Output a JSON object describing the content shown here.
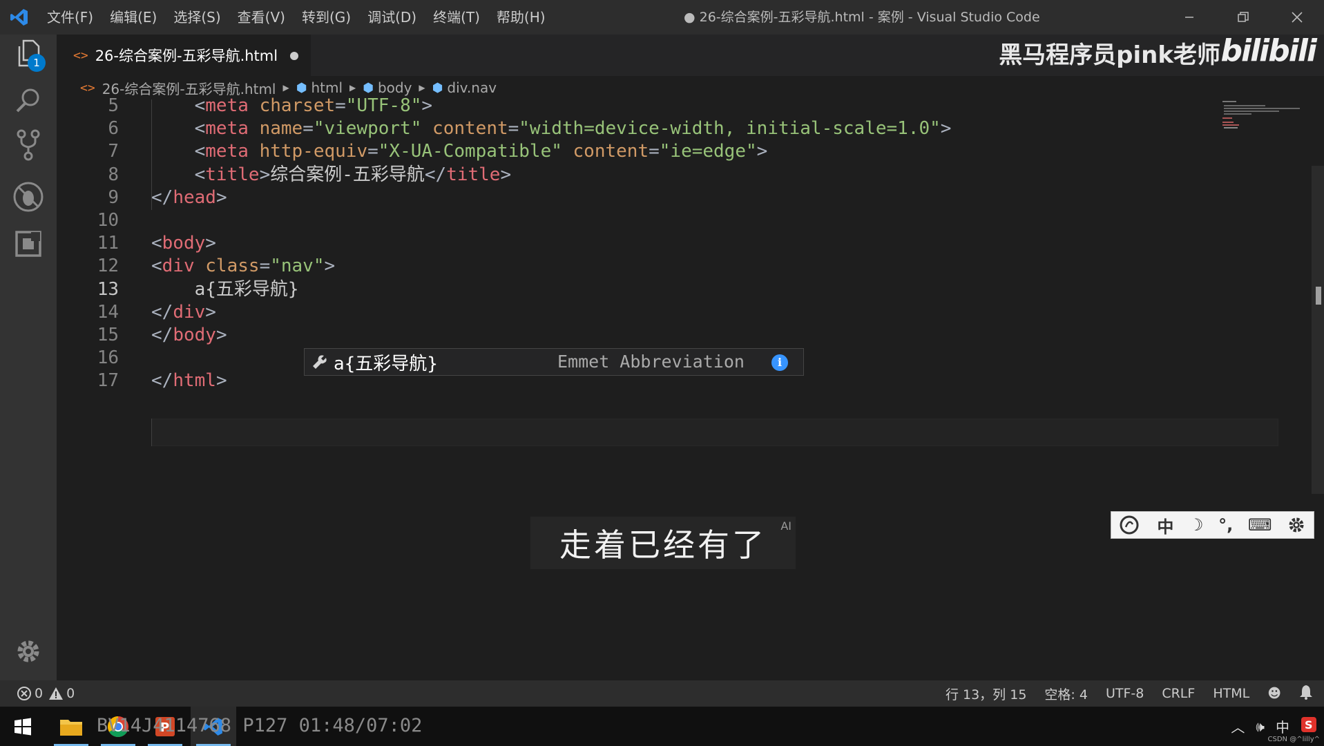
{
  "window": {
    "title": "● 26-综合案例-五彩导航.html - 案例 - Visual Studio Code"
  },
  "menu": [
    "文件(F)",
    "编辑(E)",
    "选择(S)",
    "查看(V)",
    "转到(G)",
    "调试(D)",
    "终端(T)",
    "帮助(H)"
  ],
  "activity": {
    "explorer_badge": "1"
  },
  "tab": {
    "icon": "<>",
    "label": "26-综合案例-五彩导航.html"
  },
  "watermark": {
    "author": "黑马程序员pink老师",
    "logo": "bilibili"
  },
  "breadcrumb": {
    "icon": "<>",
    "file": "26-综合案例-五彩导航.html",
    "items": [
      "html",
      "body",
      "div.nav"
    ]
  },
  "code": {
    "lines": [
      {
        "n": "5",
        "tokens": [
          [
            "p",
            "    "
          ],
          [
            "p",
            "<"
          ],
          [
            "tn",
            "meta"
          ],
          [
            "p",
            " "
          ],
          [
            "an",
            "charset"
          ],
          [
            "p",
            "="
          ],
          [
            "av",
            "\"UTF-8\""
          ],
          [
            "p",
            ">"
          ]
        ]
      },
      {
        "n": "6",
        "tokens": [
          [
            "p",
            "    "
          ],
          [
            "p",
            "<"
          ],
          [
            "tn",
            "meta"
          ],
          [
            "p",
            " "
          ],
          [
            "an",
            "name"
          ],
          [
            "p",
            "="
          ],
          [
            "av",
            "\"viewport\""
          ],
          [
            "p",
            " "
          ],
          [
            "an",
            "content"
          ],
          [
            "p",
            "="
          ],
          [
            "av",
            "\"width=device-width, initial-scale=1.0\""
          ],
          [
            "p",
            ">"
          ]
        ]
      },
      {
        "n": "7",
        "tokens": [
          [
            "p",
            "    "
          ],
          [
            "p",
            "<"
          ],
          [
            "tn",
            "meta"
          ],
          [
            "p",
            " "
          ],
          [
            "an",
            "http-equiv"
          ],
          [
            "p",
            "="
          ],
          [
            "av",
            "\"X-UA-Compatible\""
          ],
          [
            "p",
            " "
          ],
          [
            "an",
            "content"
          ],
          [
            "p",
            "="
          ],
          [
            "av",
            "\"ie=edge\""
          ],
          [
            "p",
            ">"
          ]
        ]
      },
      {
        "n": "8",
        "tokens": [
          [
            "p",
            "    "
          ],
          [
            "p",
            "<"
          ],
          [
            "tn",
            "title"
          ],
          [
            "p",
            ">"
          ],
          [
            "tx",
            "综合案例-五彩导航"
          ],
          [
            "p",
            "</"
          ],
          [
            "tn",
            "title"
          ],
          [
            "p",
            ">"
          ]
        ]
      },
      {
        "n": "9",
        "tokens": [
          [
            "p",
            "</"
          ],
          [
            "tn",
            "head"
          ],
          [
            "p",
            ">"
          ]
        ]
      },
      {
        "n": "10",
        "tokens": []
      },
      {
        "n": "11",
        "tokens": [
          [
            "p",
            "<"
          ],
          [
            "tn",
            "body"
          ],
          [
            "p",
            ">"
          ]
        ]
      },
      {
        "n": "12",
        "tokens": [
          [
            "p",
            "<"
          ],
          [
            "tn",
            "div"
          ],
          [
            "p",
            " "
          ],
          [
            "an",
            "class"
          ],
          [
            "p",
            "="
          ],
          [
            "av",
            "\"nav\""
          ],
          [
            "p",
            ">"
          ]
        ]
      },
      {
        "n": "13",
        "tokens": [
          [
            "p",
            "    "
          ],
          [
            "tx",
            "a{五彩导航}"
          ]
        ]
      },
      {
        "n": "14",
        "tokens": [
          [
            "p",
            "</"
          ],
          [
            "tn",
            "div"
          ],
          [
            "p",
            ">"
          ]
        ]
      },
      {
        "n": "15",
        "tokens": [
          [
            "p",
            "</"
          ],
          [
            "tn",
            "body"
          ],
          [
            "p",
            ">"
          ]
        ]
      },
      {
        "n": "16",
        "tokens": []
      },
      {
        "n": "17",
        "tokens": [
          [
            "p",
            "</"
          ],
          [
            "tn",
            "html"
          ],
          [
            "p",
            ">"
          ]
        ]
      }
    ],
    "active_line": "13"
  },
  "suggest": {
    "label": "a{五彩导航}",
    "detail": "Emmet Abbreviation",
    "info": "i"
  },
  "subtitle": {
    "text": "走着已经有了",
    "tag": "AI"
  },
  "ime": {
    "items": [
      "中",
      "☽",
      "°,",
      "⌨"
    ]
  },
  "status": {
    "errors": "0",
    "warnings": "0",
    "position": "行 13，列 15",
    "spaces": "空格: 4",
    "encoding": "UTF-8",
    "eol": "CRLF",
    "language": "HTML"
  },
  "taskbar": {
    "video_info": "BV14J4114768  P127  01:48/07:02",
    "tray_ime": "中",
    "tray_tiny": "CSDN @^lilly^"
  },
  "colors": {
    "accent": "#007acc",
    "tag": "#e06c75",
    "attr_name": "#d19a66",
    "attr_value": "#98c379"
  }
}
